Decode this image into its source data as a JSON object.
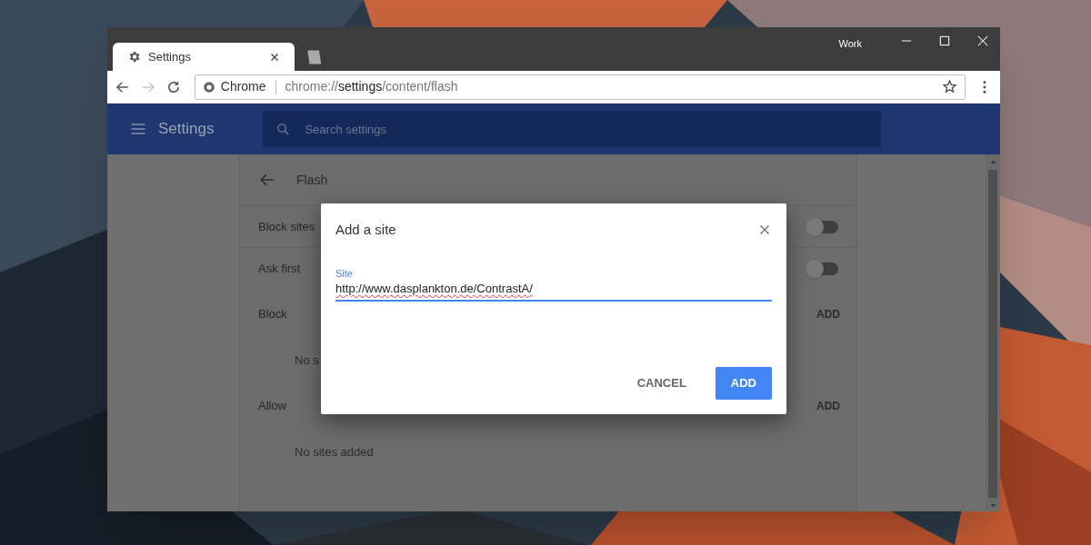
{
  "window": {
    "profile": "Work"
  },
  "tabs": [
    {
      "title": "Settings",
      "selected": true
    }
  ],
  "toolbar": {
    "forward_disabled": true,
    "chip": "Chrome",
    "url": {
      "scheme": "chrome://",
      "host": "settings",
      "path": "/content/flash"
    }
  },
  "header": {
    "title": "Settings",
    "search": {
      "placeholder": "Search settings"
    }
  },
  "page": {
    "title": "Flash",
    "rows": [
      {
        "kind": "toggle",
        "label": "Block sites",
        "on": false
      },
      {
        "kind": "toggle",
        "label": "Ask first",
        "on": false
      },
      {
        "kind": "section",
        "label": "Block",
        "action": "ADD"
      },
      {
        "kind": "empty",
        "label": "No s"
      },
      {
        "kind": "section",
        "label": "Allow",
        "action": "ADD"
      },
      {
        "kind": "empty",
        "label": "No sites added"
      }
    ]
  },
  "dialog": {
    "title": "Add a site",
    "field": {
      "label": "Site",
      "value": "http://www.dasplankton.de/ContrastA/"
    },
    "buttons": [
      {
        "label": "CANCEL",
        "kind": "text"
      },
      {
        "label": "ADD",
        "kind": "primary"
      }
    ]
  }
}
